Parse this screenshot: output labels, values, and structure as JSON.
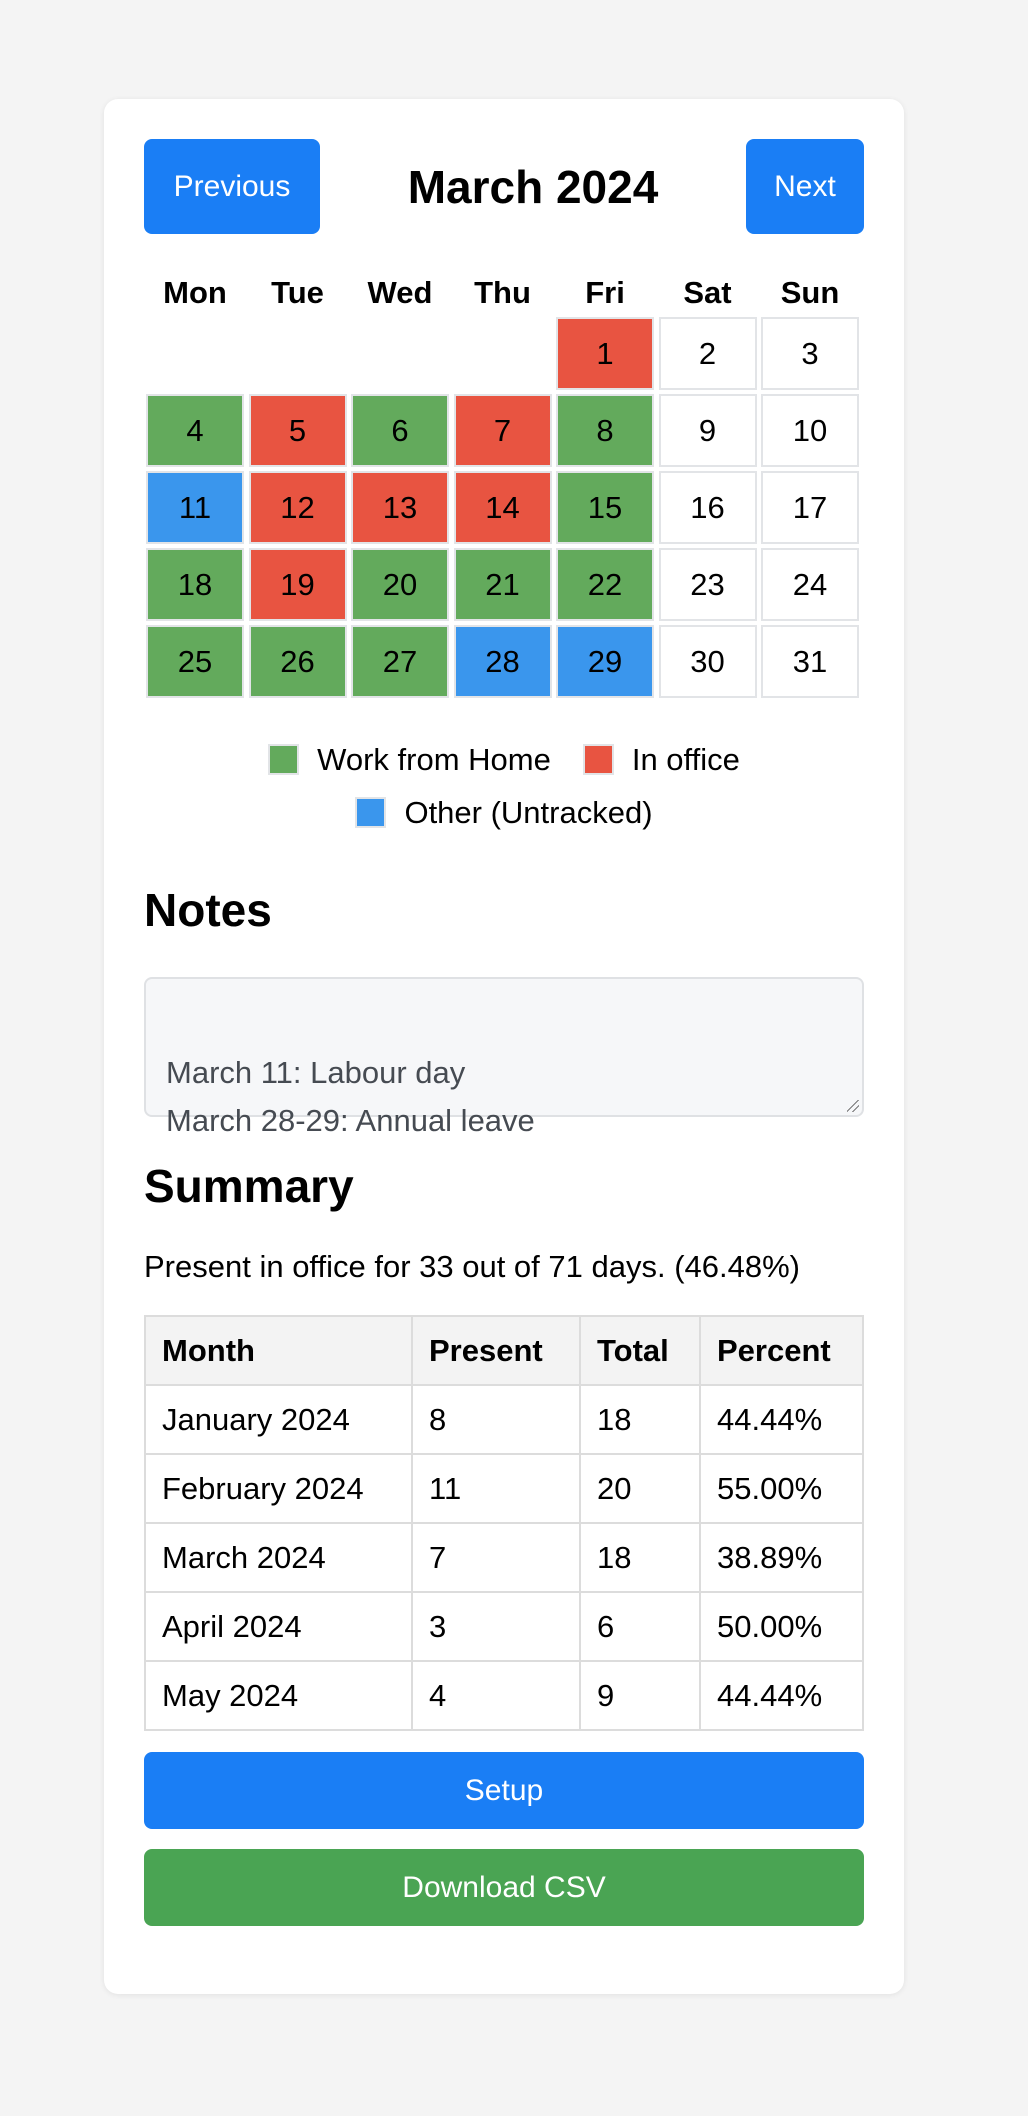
{
  "colors": {
    "page_background": "#f4f4f4",
    "primary_blue": "#1a7ef5",
    "download_green": "#4aa453",
    "status": {
      "wfh": "#63aa5c",
      "office": "#e85441",
      "other": "#3a96ed",
      "none": "#ffffff"
    }
  },
  "header": {
    "previous_label": "Previous",
    "month_title": "March 2024",
    "next_label": "Next"
  },
  "calendar": {
    "weekdays": [
      "Mon",
      "Tue",
      "Wed",
      "Thu",
      "Fri",
      "Sat",
      "Sun"
    ],
    "leading_blanks": 4,
    "days": [
      {
        "day": "1",
        "status": "office"
      },
      {
        "day": "2",
        "status": "none"
      },
      {
        "day": "3",
        "status": "none"
      },
      {
        "day": "4",
        "status": "wfh"
      },
      {
        "day": "5",
        "status": "office"
      },
      {
        "day": "6",
        "status": "wfh"
      },
      {
        "day": "7",
        "status": "office"
      },
      {
        "day": "8",
        "status": "wfh"
      },
      {
        "day": "9",
        "status": "none"
      },
      {
        "day": "10",
        "status": "none"
      },
      {
        "day": "11",
        "status": "other"
      },
      {
        "day": "12",
        "status": "office"
      },
      {
        "day": "13",
        "status": "office"
      },
      {
        "day": "14",
        "status": "office"
      },
      {
        "day": "15",
        "status": "wfh"
      },
      {
        "day": "16",
        "status": "none"
      },
      {
        "day": "17",
        "status": "none"
      },
      {
        "day": "18",
        "status": "wfh"
      },
      {
        "day": "19",
        "status": "office"
      },
      {
        "day": "20",
        "status": "wfh"
      },
      {
        "day": "21",
        "status": "wfh"
      },
      {
        "day": "22",
        "status": "wfh"
      },
      {
        "day": "23",
        "status": "none"
      },
      {
        "day": "24",
        "status": "none"
      },
      {
        "day": "25",
        "status": "wfh"
      },
      {
        "day": "26",
        "status": "wfh"
      },
      {
        "day": "27",
        "status": "wfh"
      },
      {
        "day": "28",
        "status": "other"
      },
      {
        "day": "29",
        "status": "other"
      },
      {
        "day": "30",
        "status": "none"
      },
      {
        "day": "31",
        "status": "none"
      }
    ]
  },
  "legend": {
    "wfh_label": "Work from Home",
    "office_label": "In office",
    "other_label": "Other (Untracked)"
  },
  "notes": {
    "title": "Notes",
    "value": "March 11: Labour day\nMarch 28-29: Annual leave"
  },
  "summary": {
    "title": "Summary",
    "text": "Present in office for 33 out of 71 days. (46.48%)",
    "table": {
      "headers": [
        "Month",
        "Present",
        "Total",
        "Percent"
      ],
      "rows": [
        [
          "January 2024",
          "8",
          "18",
          "44.44%"
        ],
        [
          "February 2024",
          "11",
          "20",
          "55.00%"
        ],
        [
          "March 2024",
          "7",
          "18",
          "38.89%"
        ],
        [
          "April 2024",
          "3",
          "6",
          "50.00%"
        ],
        [
          "May 2024",
          "4",
          "9",
          "44.44%"
        ]
      ]
    }
  },
  "actions": {
    "setup_label": "Setup",
    "download_label": "Download CSV"
  }
}
